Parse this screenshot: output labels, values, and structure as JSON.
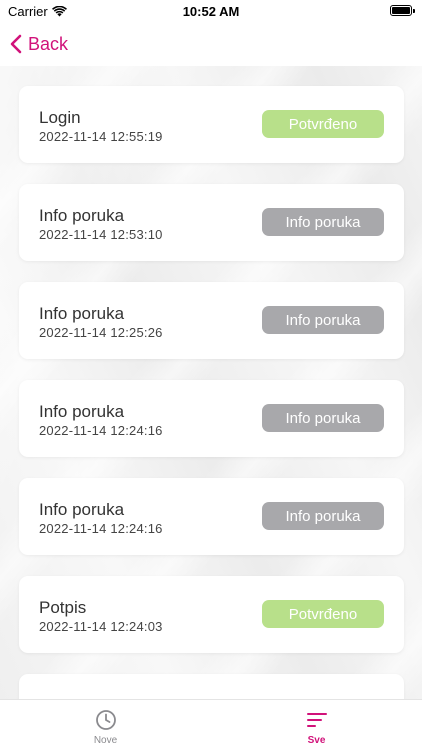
{
  "status_bar": {
    "carrier": "Carrier",
    "time": "10:52 AM"
  },
  "nav": {
    "back_label": "Back",
    "accent_color": "#d1127a"
  },
  "items": [
    {
      "title": "Login",
      "date": "2022-11-14 12:55:19",
      "badge": "Potvrđeno",
      "badge_type": "confirmed"
    },
    {
      "title": "Info poruka",
      "date": "2022-11-14 12:53:10",
      "badge": "Info poruka",
      "badge_type": "info"
    },
    {
      "title": "Info poruka",
      "date": "2022-11-14 12:25:26",
      "badge": "Info poruka",
      "badge_type": "info"
    },
    {
      "title": "Info poruka",
      "date": "2022-11-14 12:24:16",
      "badge": "Info poruka",
      "badge_type": "info"
    },
    {
      "title": "Info poruka",
      "date": "2022-11-14 12:24:16",
      "badge": "Info poruka",
      "badge_type": "info"
    },
    {
      "title": "Potpis",
      "date": "2022-11-14 12:24:03",
      "badge": "Potvrđeno",
      "badge_type": "confirmed"
    }
  ],
  "badge_colors": {
    "confirmed": "#b8e08a",
    "info": "#a8a8ab"
  },
  "tabs": [
    {
      "label": "Nove",
      "icon": "clock-icon",
      "active": false
    },
    {
      "label": "Sve",
      "icon": "sort-lines-icon",
      "active": true
    }
  ]
}
